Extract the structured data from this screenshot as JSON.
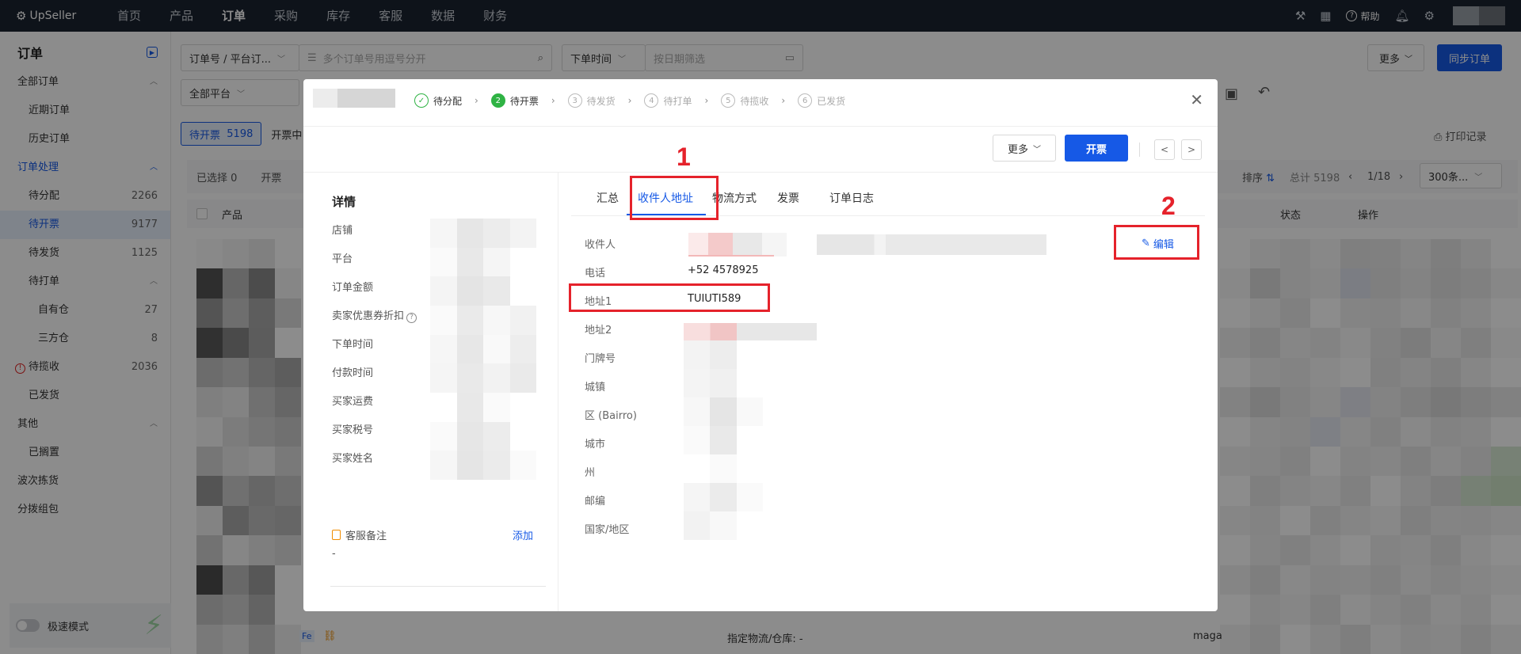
{
  "app": {
    "logo": "UpSeller"
  },
  "topnav": [
    "首页",
    "产品",
    "订单",
    "采购",
    "库存",
    "客服",
    "数据",
    "财务"
  ],
  "top_right": {
    "help": "帮助"
  },
  "sidebar": {
    "title": "订单",
    "items": [
      {
        "label": "全部订单",
        "chev": "^"
      },
      {
        "label": "近期订单"
      },
      {
        "label": "历史订单"
      },
      {
        "label": "订单处理",
        "chev": "^"
      },
      {
        "label": "待分配",
        "count": "2266"
      },
      {
        "label": "待开票",
        "count": "9177"
      },
      {
        "label": "待发货",
        "count": "1125"
      },
      {
        "label": "待打单",
        "chev": "^"
      },
      {
        "label": "自有仓",
        "count": "27"
      },
      {
        "label": "三方仓",
        "count": "8"
      },
      {
        "label": "待揽收",
        "count": "2036"
      },
      {
        "label": "已发货"
      },
      {
        "label": "其他",
        "chev": "^"
      },
      {
        "label": "已搁置"
      },
      {
        "label": "波次拣货"
      },
      {
        "label": "分拨组包"
      }
    ],
    "speed_mode": "极速模式"
  },
  "main": {
    "search_type": "订单号 / 平台订...",
    "search_placeholder": "多个订单号用逗号分开",
    "time_type": "下单时间",
    "date_placeholder": "按日期筛选",
    "more": "更多",
    "sync": "同步订单",
    "platform": "全部平台",
    "tab_pill": "待开票",
    "tab_pill_count": "5198",
    "tab_pill_next": "开票中",
    "print_record": "打印记录",
    "selected": "已选择 0",
    "invoice_btn": "开票",
    "sort": "排序",
    "total": "总计 5198",
    "page": "1/18",
    "page_size": "300条...",
    "col_product": "产品",
    "col_status": "状态",
    "col_action": "操作",
    "row_text": "指定物流/仓库: -",
    "fe_tag": "Fe",
    "row_text_right": "maga"
  },
  "modal": {
    "steps": [
      {
        "num": "✓",
        "label": "待分配"
      },
      {
        "num": "2",
        "label": "待开票"
      },
      {
        "num": "3",
        "label": "待发货"
      },
      {
        "num": "4",
        "label": "待打单"
      },
      {
        "num": "5",
        "label": "待揽收"
      },
      {
        "num": "6",
        "label": "已发货"
      }
    ],
    "more": "更多",
    "invoice": "开票",
    "prev": "<",
    "next": ">",
    "details_title": "详情",
    "detail_fields": [
      "店铺",
      "平台",
      "订单金额",
      "卖家优惠券折扣",
      "下单时间",
      "付款时间",
      "买家运费",
      "买家税号",
      "买家姓名"
    ],
    "note_label": "客服备注",
    "note_add": "添加",
    "note_value": "-",
    "tabs": [
      "汇总",
      "收件人地址",
      "物流方式",
      "发票",
      "订单日志"
    ],
    "address": [
      {
        "label": "收件人",
        "value": ""
      },
      {
        "label": "电话",
        "value": "+52 4578925"
      },
      {
        "label": "地址1",
        "value": "TUIUTI589"
      },
      {
        "label": "地址2",
        "value": ""
      },
      {
        "label": "门牌号",
        "value": ""
      },
      {
        "label": "城镇",
        "value": ""
      },
      {
        "label": "区 (Bairro)",
        "value": ""
      },
      {
        "label": "城市",
        "value": ""
      },
      {
        "label": "州",
        "value": ""
      },
      {
        "label": "邮编",
        "value": ""
      },
      {
        "label": "国家/地区",
        "value": ""
      }
    ],
    "edit": "编辑"
  },
  "annotations": {
    "one": "1",
    "two": "2"
  }
}
